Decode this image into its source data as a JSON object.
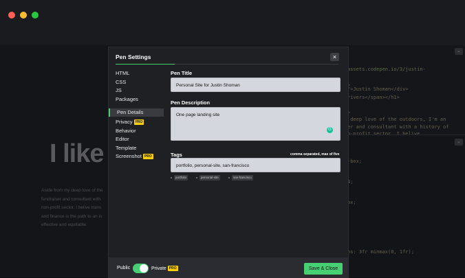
{
  "modal": {
    "title": "Pen Settings",
    "close_icon": "×",
    "nav_top": [
      "HTML",
      "CSS",
      "JS",
      "Packages"
    ],
    "nav_bottom": [
      {
        "label": "Pen Details",
        "active": true,
        "pro": ""
      },
      {
        "label": "Privacy",
        "active": false,
        "pro": "PRO"
      },
      {
        "label": "Behavior",
        "active": false,
        "pro": ""
      },
      {
        "label": "Editor",
        "active": false,
        "pro": ""
      },
      {
        "label": "Template",
        "active": false,
        "pro": ""
      },
      {
        "label": "Screenshot",
        "active": false,
        "pro": "PRO"
      }
    ],
    "pen_title_label": "Pen Title",
    "pen_title_value": "Personal Site for Justin Shoman",
    "pen_description_label": "Pen Description",
    "pen_description_value": "One page landing site",
    "tags_label": "Tags",
    "tags_hint": "comma separated, max of five",
    "tags_value": "portfolio, personal-site, san-francisco",
    "tag_chips": [
      "portfolio",
      "personal-site",
      "san-francisco"
    ],
    "footer": {
      "public_label": "Public",
      "private_label": "Private",
      "private_pro": "PRO",
      "save_label": "Save & Close"
    }
  },
  "background": {
    "heading": "I like",
    "paragraph": [
      "Aside from my deep love of the",
      "fundraiser and consultant with",
      "non-profit sector. I belive trans",
      "and finance is the path to an in",
      "effective and equitable."
    ],
    "code_top": [
      "assets.codepen.io/3/justin-",
      ">",
      "\">Justin Shoman</div>",
      "rivers</span></h1>",
      ">",
      " deep love of the outdoors, I'm an",
      "er and consultant with a history of",
      "n-profit sector. I belive"
    ],
    "code_bottom": [
      "-box;",
      "",
      "4;",
      "",
      "px;"
    ],
    "code_last": "ns: 3fr minmax(0, 1fr);"
  },
  "icons": {
    "collapse": "chevron-down-icon",
    "grammarly": "grammarly-icon"
  }
}
